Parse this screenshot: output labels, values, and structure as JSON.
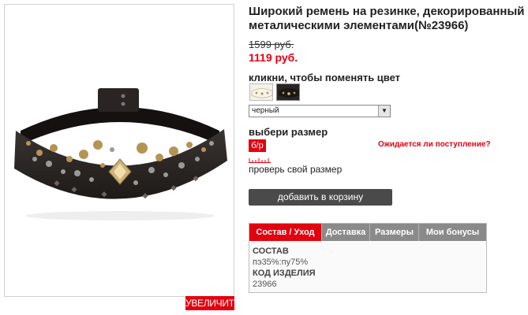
{
  "product": {
    "title": "Широкий ремень на резинке, декорированный металическими элементами(№23966)",
    "old_price": "1599 руб.",
    "new_price": "1119 руб."
  },
  "image": {
    "zoom_label": "УВЕЛИЧИТЬ",
    "icon": "belt-photo"
  },
  "color": {
    "hint": "кликни, чтобы поменять цвет",
    "swatches": [
      "white",
      "black"
    ],
    "selected": "черный"
  },
  "size": {
    "heading": "выбери размер",
    "chip": "б/р",
    "restock_link": "Ожидается ли поступление?",
    "check_link": "проверь свой размер"
  },
  "cart": {
    "button_label": "добавить в корзину"
  },
  "tabs": {
    "items": [
      "Состав / Уход",
      "Доставка",
      "Размеры",
      "Мои бонусы"
    ],
    "active": "Состав / Уход",
    "content": {
      "composition_heading": "СОСТАВ",
      "composition_value": "пэ35%:пу75%",
      "code_heading": "КОД ИЗДЕЛИЯ",
      "code_value": "23966"
    }
  },
  "colors": {
    "accent": "#e3000f",
    "button": "#4a4a4a",
    "tab_bar": "#8a8a8a"
  }
}
